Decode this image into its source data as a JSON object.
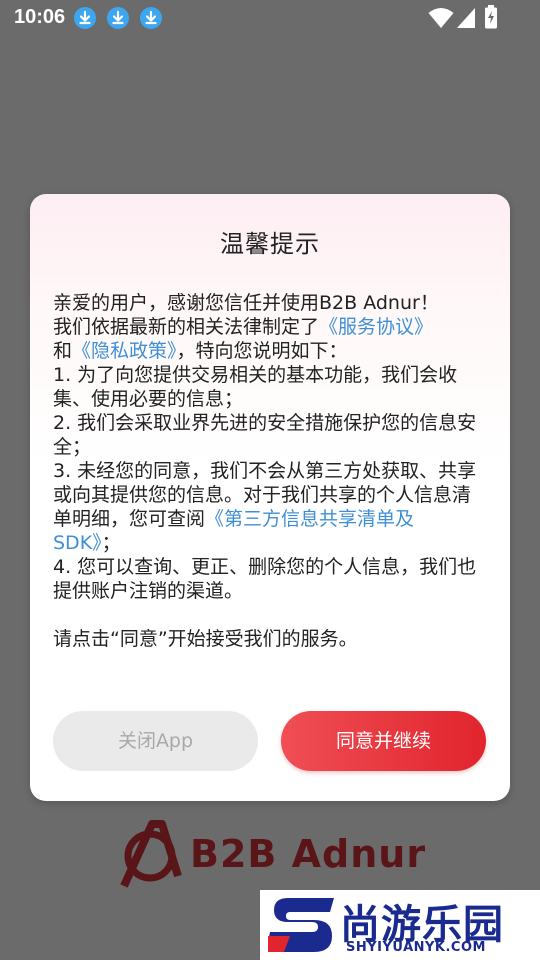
{
  "status_bar": {
    "time": "10:06"
  },
  "dialog": {
    "title": "温馨提示",
    "line1": "亲爱的用户，感谢您信任并使用B2B Adnur！",
    "line2_prefix": "我们依据最新的相关法律制定了",
    "service_agreement_link": "《服务协议》",
    "line3_prefix": "和",
    "privacy_policy_link": "《隐私政策》",
    "line3_suffix": "，特向您说明如下：",
    "item1": "1. 为了向您提供交易相关的基本功能，我们会收集、使用必要的信息；",
    "item2": "2. 我们会采取业界先进的安全措施保护您的信息安全；",
    "item3_prefix": "3. 未经您的同意，我们不会从第三方处获取、共享或向其提供您的信息。对于我们共享的个人信息清单明细，您可查阅",
    "third_party_link": "《第三方信息共享清单及SDK》",
    "item3_suffix": "；",
    "item4": "4. 您可以查询、更正、删除您的个人信息，我们也提供账户注销的渠道。",
    "closing": "请点击“同意”开始接受我们的服务。",
    "close_button": "关闭App",
    "agree_button": "同意并继续"
  },
  "background": {
    "logo_text": "B2B Adnur"
  },
  "watermark": {
    "text": "尚游乐园",
    "url": "SHYIYUANYK.COM"
  },
  "colors": {
    "accent": "#e1242d",
    "link": "#3f8fd6",
    "watermark": "#1a2a8f"
  }
}
